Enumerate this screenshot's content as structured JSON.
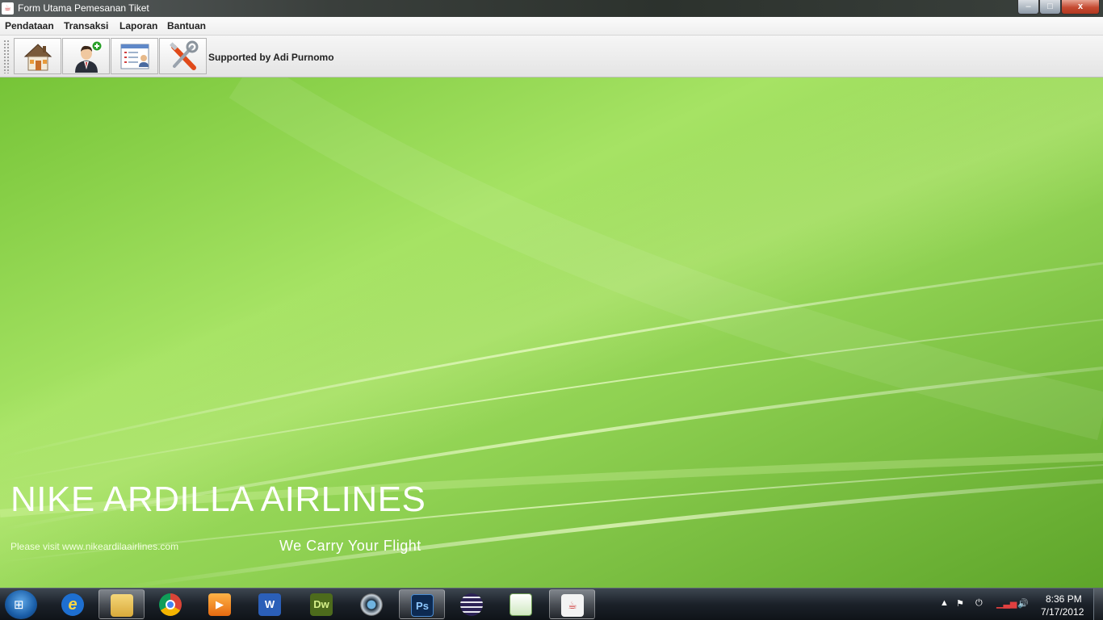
{
  "window": {
    "title": "Form Utama Pemesanan Tiket",
    "app_icon": "java-cup-icon",
    "controls": {
      "minimize": "‒",
      "maximize": "□",
      "close": "x"
    }
  },
  "menu": {
    "items": [
      "Pendataan",
      "Transaksi",
      "Laporan",
      "Bantuan"
    ]
  },
  "toolbar": {
    "buttons": [
      {
        "icon": "home-icon"
      },
      {
        "icon": "add-user-icon"
      },
      {
        "icon": "report-form-icon"
      },
      {
        "icon": "tools-icon"
      }
    ],
    "credit": "Supported by Adi Purnomo"
  },
  "banner": {
    "brand": "NIKE ARDILLA AIRLINES",
    "visit": "Please visit www.nikeardilaairlines.com",
    "tagline": "We Carry Your Flight",
    "colors": {
      "green_light": "#a6e364",
      "green_dark": "#5ea52a"
    }
  },
  "taskbar": {
    "start_icon": "windows-start-icon",
    "apps": [
      {
        "icon": "internet-explorer-icon",
        "label": "e",
        "active": false
      },
      {
        "icon": "file-explorer-icon",
        "label": "",
        "active": true
      },
      {
        "icon": "chrome-icon",
        "label": "",
        "active": false
      },
      {
        "icon": "media-player-icon",
        "label": "▶",
        "active": false
      },
      {
        "icon": "word-icon",
        "label": "W",
        "active": false
      },
      {
        "icon": "dreamweaver-icon",
        "label": "Dw",
        "active": false
      },
      {
        "icon": "camera-app-icon",
        "label": "",
        "active": false
      },
      {
        "icon": "photoshop-icon",
        "label": "Ps",
        "active": true
      },
      {
        "icon": "eclipse-icon",
        "label": "",
        "active": false
      },
      {
        "icon": "editor-icon",
        "label": "",
        "active": false
      },
      {
        "icon": "java-icon",
        "label": "",
        "active": true
      }
    ],
    "tray": {
      "time": "8:36 PM",
      "date": "7/17/2012"
    }
  }
}
